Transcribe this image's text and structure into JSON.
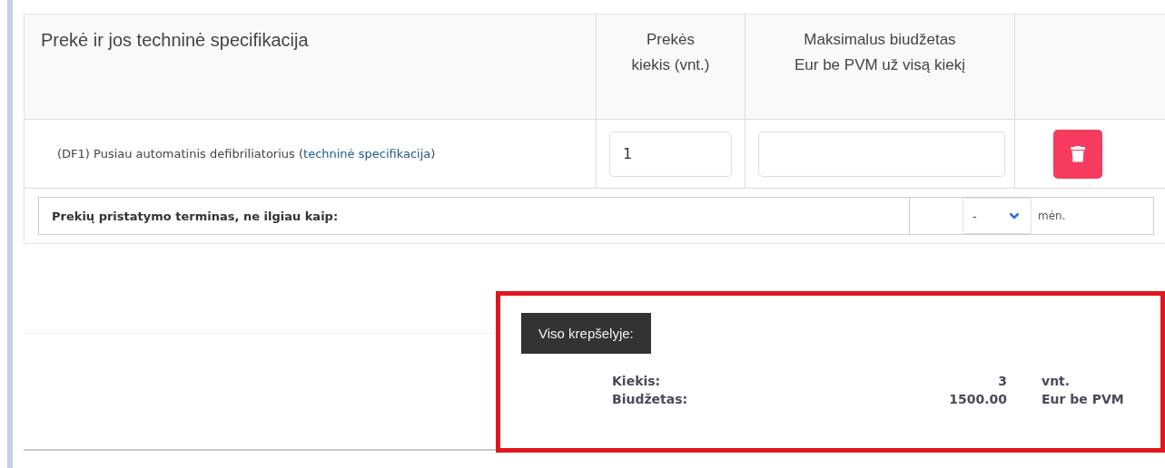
{
  "table": {
    "columns": [
      {
        "lines": [
          "Prekė ir jos techninė specifikacija"
        ]
      },
      {
        "lines": [
          "Prekės",
          "kiekis (vnt.)"
        ]
      },
      {
        "lines": [
          "Maksimalus biudžetas",
          "Eur be PVM už visą kiekį"
        ]
      },
      {}
    ],
    "rows": [
      {
        "name": "(DF1) Pusiau automatinis defibriliatorius (",
        "link": "techninė specifikacija",
        "name_end": ")",
        "quantity": "1",
        "budget": ""
      }
    ]
  },
  "delivery": {
    "label": "Prekių pristatymo terminas, ne ilgiau kaip:",
    "select_value": "-",
    "unit": "mėn."
  },
  "cart": {
    "title": "Viso krepšelyje:",
    "highlighted": true,
    "lines": [
      {
        "label": "Kiekis:",
        "value": "3",
        "unit": "vnt."
      },
      {
        "label": "Biudžetas:",
        "value": "1500.00",
        "unit": "Eur be PVM"
      }
    ]
  }
}
